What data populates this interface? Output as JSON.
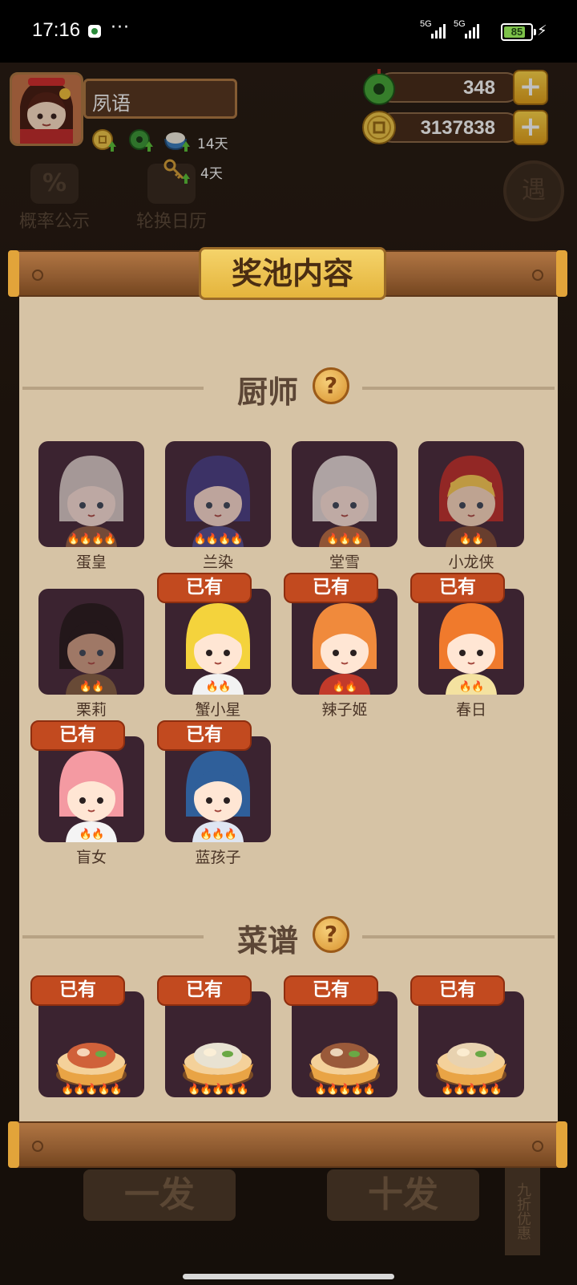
{
  "status_bar": {
    "time": "17:16",
    "dots": "···",
    "network_1": "5G",
    "network_2": "5G",
    "battery": "85",
    "charging_icon": "bolt-icon"
  },
  "player": {
    "name": "夙语",
    "buffs": [
      {
        "icon": "coin-up-icon",
        "label": ""
      },
      {
        "icon": "jade-up-icon",
        "label": ""
      },
      {
        "icon": "rice-bowl-up-icon",
        "label": "14天"
      },
      {
        "icon": "key-up-icon",
        "label": "4天"
      }
    ]
  },
  "resources": {
    "jade": {
      "icon": "jade-icon",
      "value": "348",
      "plus": "+"
    },
    "coins": {
      "icon": "coin-icon",
      "value": "3137838",
      "plus": "+"
    }
  },
  "background": {
    "probability_btn": "概率公示",
    "probability_icon": "%",
    "calendar_btn": "轮换日历",
    "right_round": "遇",
    "bottom_single": "一发",
    "bottom_ten": "十发",
    "bottom_side": "九折优惠"
  },
  "modal": {
    "title": "奖池内容",
    "help_glyph": "?",
    "owned_label": "已有",
    "chef_section": {
      "title": "厨师",
      "items": [
        {
          "name": "蛋皇",
          "owned": false,
          "stars": 4
        },
        {
          "name": "兰染",
          "owned": false,
          "stars": 4
        },
        {
          "name": "堂雪",
          "owned": false,
          "stars": 3
        },
        {
          "name": "小龙侠",
          "owned": false,
          "stars": 2
        },
        {
          "name": "栗莉",
          "owned": false,
          "stars": 2
        },
        {
          "name": "蟹小星",
          "owned": true,
          "stars": 2
        },
        {
          "name": "辣子姬",
          "owned": true,
          "stars": 2
        },
        {
          "name": "春日",
          "owned": true,
          "stars": 2
        },
        {
          "name": "盲女",
          "owned": true,
          "stars": 2
        },
        {
          "name": "蓝孩子",
          "owned": true,
          "stars": 3
        }
      ]
    },
    "recipe_section": {
      "title": "菜谱",
      "items": [
        {
          "owned": true,
          "stars": 5
        },
        {
          "owned": true,
          "stars": 5
        },
        {
          "owned": true,
          "stars": 5
        },
        {
          "owned": true,
          "stars": 5
        }
      ]
    }
  },
  "colors": {
    "panel": "#d6c3a5",
    "card": "#3b2330",
    "owned_badge": "#c24a1f",
    "gold": "#f0c24a"
  }
}
